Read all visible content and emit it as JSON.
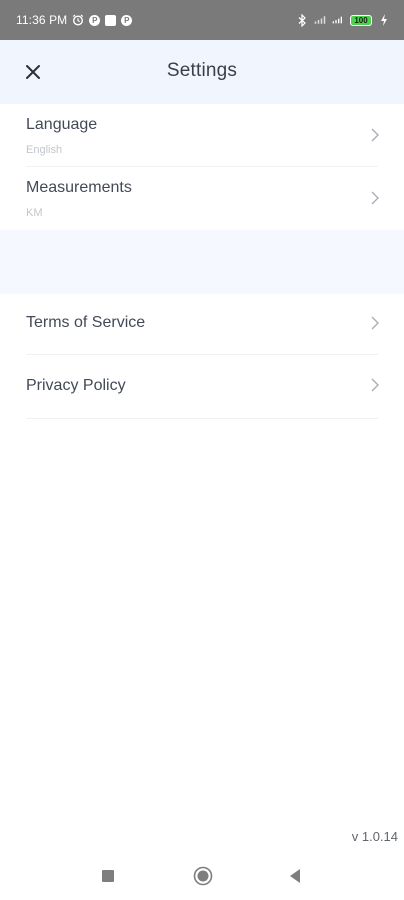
{
  "status_bar": {
    "time": "11:36 PM",
    "battery": "100",
    "icons": [
      "alarm-icon",
      "app-notification-icon",
      "square-notification-icon",
      "app-notification-icon",
      "bluetooth-icon",
      "signal-icon",
      "signal-icon",
      "battery-icon",
      "charging-icon"
    ]
  },
  "app_bar": {
    "title": "Settings",
    "close_icon": "close-icon"
  },
  "settings": {
    "language": {
      "label": "Language",
      "value": "English"
    },
    "measurements": {
      "label": "Measurements",
      "value": "KM"
    }
  },
  "legal": {
    "terms": {
      "label": "Terms of Service"
    },
    "privacy": {
      "label": "Privacy Policy"
    }
  },
  "footer": {
    "version": "v 1.0.14"
  },
  "colors": {
    "status_bar_bg": "#7a7a7a",
    "app_bar_bg": "#f1f5fd",
    "text_primary": "#434956",
    "text_secondary": "#c2c6cc",
    "battery_fill": "#4bd44b"
  }
}
